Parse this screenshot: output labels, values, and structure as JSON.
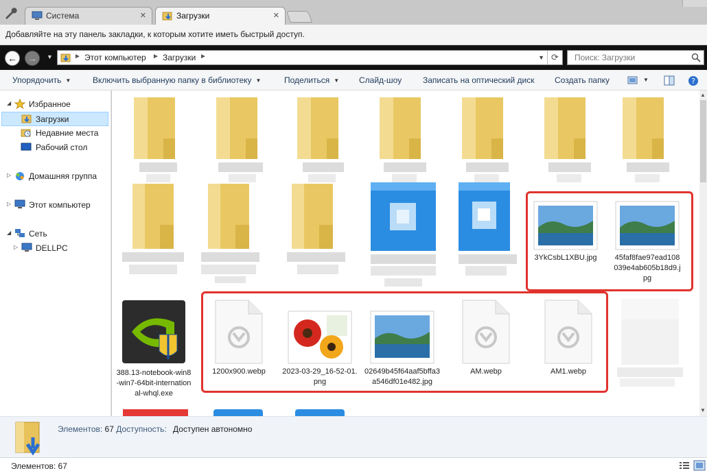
{
  "tabs": [
    {
      "label": "Система",
      "icon": "system-icon",
      "active": false
    },
    {
      "label": "Загрузки",
      "icon": "downloads-folder-icon",
      "active": true
    }
  ],
  "tab_close_glyph": "✕",
  "bookmarks_bar": {
    "text": "Добавляйте на эту панель закладки, к которым хотите иметь быстрый доступ."
  },
  "address": {
    "breadcrumbs": [
      "Этот компьютер",
      "Загрузки"
    ],
    "search_placeholder": "Поиск: Загрузки"
  },
  "toolbar": {
    "organize": "Упорядочить",
    "include_library": "Включить выбранную папку в библиотеку",
    "share": "Поделиться",
    "slideshow": "Слайд-шоу",
    "burn": "Записать на оптический диск",
    "new_folder": "Создать папку"
  },
  "nav": {
    "favorites": "Избранное",
    "downloads": "Загрузки",
    "recent": "Недавние места",
    "desktop": "Рабочий стол",
    "homegroup": "Домашняя группа",
    "computer": "Этот компьютер",
    "network": "Сеть",
    "dellpc": "DELLPC"
  },
  "files": {
    "img1": "3YkCsbL1XBU.jpg",
    "img2": "45faf8fae97ead108039e4ab605b18d9.jpg",
    "exe": "388.13-notebook-win8-win7-64bit-international-whql.exe",
    "webp1": "1200x900.webp",
    "png": "2023-03-29_16-52-01.png",
    "jpg3": "02649b45f64aaf5bffa3a546df01e482.jpg",
    "am": "AM.webp",
    "am1": "AM1.webp"
  },
  "details": {
    "items_label": "Элементов:",
    "items_count": "67",
    "availability_label": "Доступность:",
    "availability_value": "Доступен автономно"
  },
  "status": {
    "items_text": "Элементов: 67"
  },
  "colors": {
    "highlight": "#e0332d",
    "selection": "#cce8ff",
    "folder": "#e8c25a",
    "accent_blue": "#2b8de2",
    "nvidia_green": "#76b900"
  }
}
